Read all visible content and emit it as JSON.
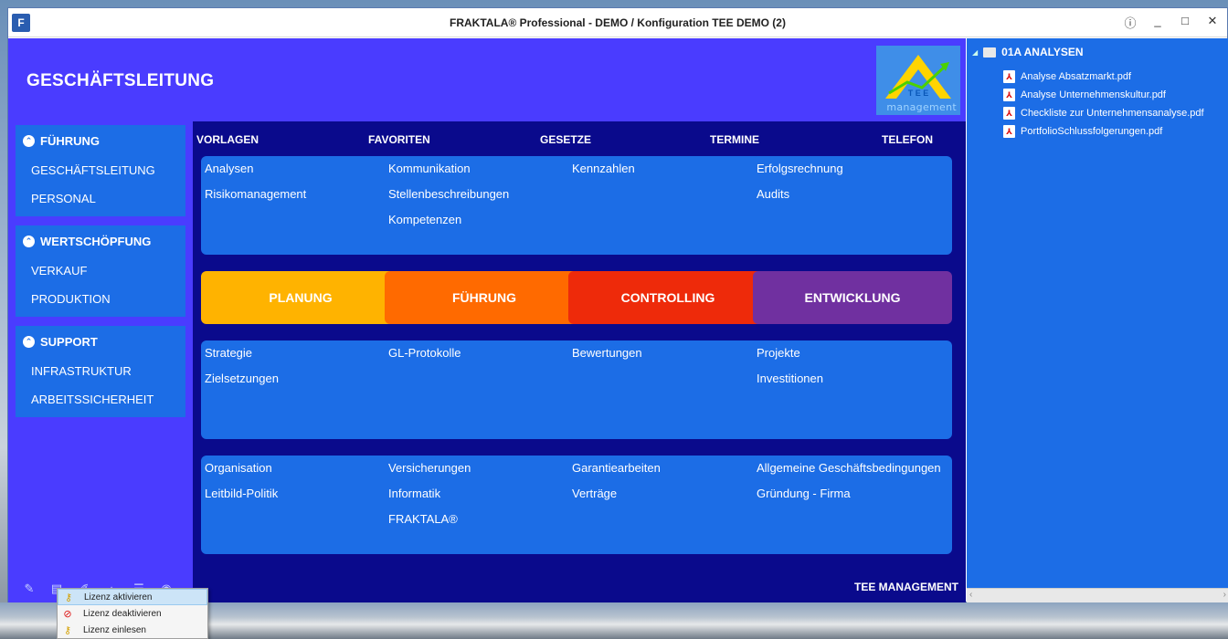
{
  "window": {
    "app_icon": "F",
    "title": "FRAKTALA® Professional - DEMO / Konfiguration TEE DEMO (2)",
    "controls": {
      "info": "ⓘ",
      "minimize": "_",
      "maximize": "□",
      "close": "✕"
    }
  },
  "header": {
    "title": "GESCHÄFTSLEITUNG",
    "logo_text": "management"
  },
  "sidebar": {
    "groups": [
      {
        "label": "FÜHRUNG",
        "items": [
          "GESCHÄFTSLEITUNG",
          "PERSONAL"
        ]
      },
      {
        "label": "WERTSCHÖPFUNG",
        "items": [
          "VERKAUF",
          "PRODUKTION"
        ]
      },
      {
        "label": "SUPPORT",
        "items": [
          "INFRASTRUKTUR",
          "ARBEITSSICHERHEIT"
        ]
      }
    ]
  },
  "top_links": [
    "VORLAGEN",
    "FAVORITEN",
    "GESETZE",
    "TERMINE",
    "TELEFON"
  ],
  "tiles_row1": [
    [
      "Analysen",
      "Risikomanagement"
    ],
    [
      "Kommunikation",
      "Stellenbeschreibungen",
      "Kompetenzen"
    ],
    [
      "Kennzahlen"
    ],
    [
      "Erfolgsrechnung",
      "Audits"
    ]
  ],
  "categories": [
    {
      "label": "PLANUNG",
      "color": "#ffb300"
    },
    {
      "label": "FÜHRUNG",
      "color": "#ff6a00"
    },
    {
      "label": "CONTROLLING",
      "color": "#ee2a0a"
    },
    {
      "label": "ENTWICKLUNG",
      "color": "#7030a0"
    }
  ],
  "tiles_row2": [
    [
      "Strategie",
      "Zielsetzungen"
    ],
    [
      "GL-Protokolle"
    ],
    [
      "Bewertungen"
    ],
    [
      "Projekte",
      "Investitionen"
    ]
  ],
  "tiles_row3": [
    [
      "Organisation",
      "Leitbild-Politik"
    ],
    [
      "Versicherungen",
      "Informatik",
      "FRAKTALA®"
    ],
    [
      "Garantiearbeiten",
      "Verträge"
    ],
    [
      "Allgemeine Geschäftsbedingungen",
      "Gründung - Firma"
    ]
  ],
  "footer_label": "TEE MANAGEMENT",
  "context_menu": [
    {
      "label": "Lizenz aktivieren",
      "icon": "key-icon"
    },
    {
      "label": "Lizenz deaktivieren",
      "icon": "forbidden-icon"
    },
    {
      "label": "Lizenz einlesen",
      "icon": "key-import-icon"
    }
  ],
  "tree": {
    "root": "01A ANALYSEN",
    "files": [
      "Analyse Absatzmarkt.pdf",
      "Analyse Unternehmenskultur.pdf",
      "Checkliste zur Unternehmensanalyse.pdf",
      "PortfolioSchlussfolgerungen.pdf"
    ]
  },
  "colors": {
    "app_background": "#4a3cff",
    "center_background": "#0a0a8c",
    "tile": "#1c6de6"
  }
}
